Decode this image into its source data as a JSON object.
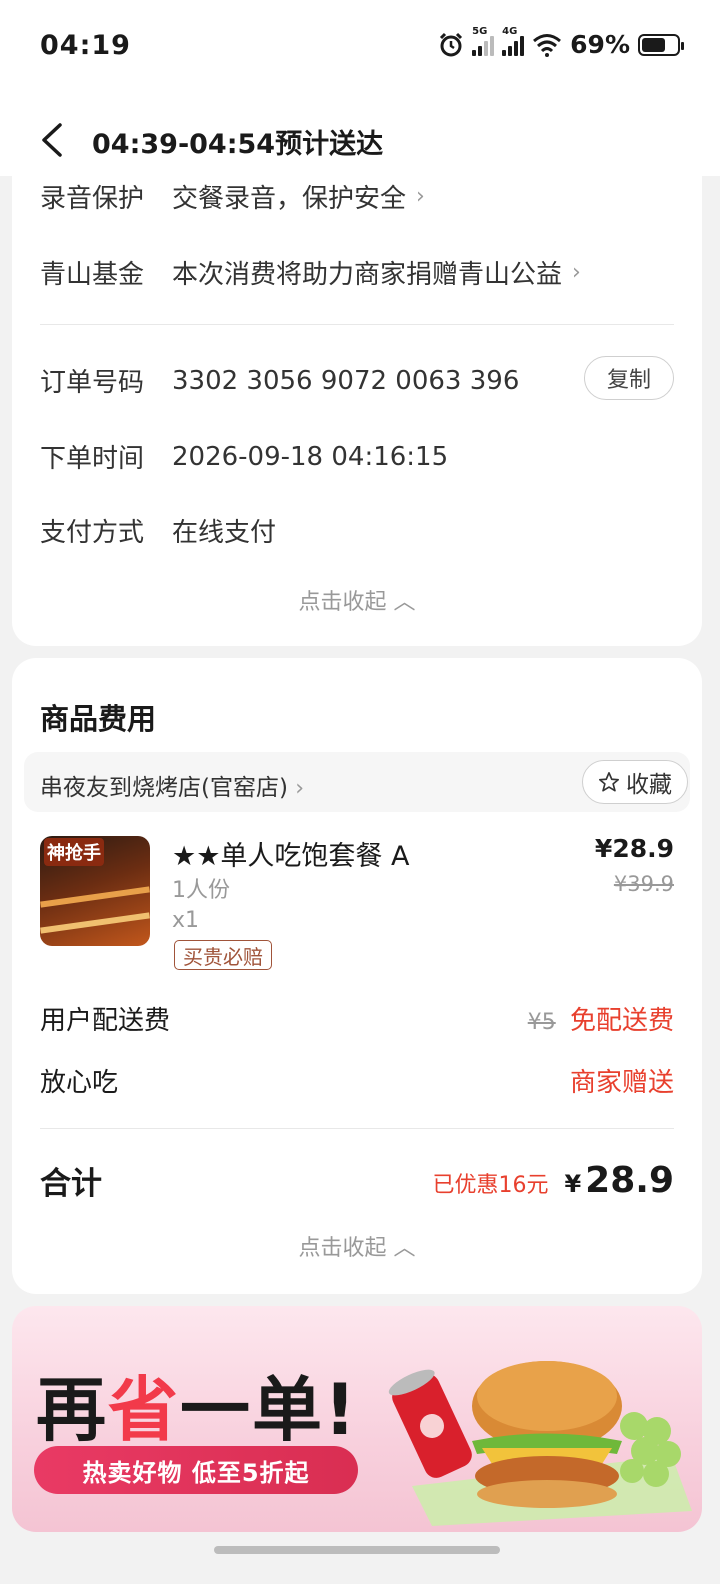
{
  "status_bar": {
    "time": "04:19",
    "signal_a_label": "5G",
    "signal_b_label": "4G",
    "battery_percent": "69%",
    "icons": [
      "alarm-icon",
      "signal-5g-icon",
      "signal-4g-icon",
      "wifi-icon",
      "battery-icon"
    ]
  },
  "nav": {
    "title": "04:39-04:54预计送达",
    "back_icon": "back-chevron-icon"
  },
  "order_info": {
    "rows": [
      {
        "key": "录音保护",
        "value": "交餐录音，保护安全"
      },
      {
        "key": "青山基金",
        "value": "本次消费将助力商家捐赠青山公益"
      },
      {
        "key": "订单号码",
        "value": "3302 3056 9072 0063 396"
      },
      {
        "key": "下单时间",
        "value": "2026-09-18 04:16:15"
      },
      {
        "key": "支付方式",
        "value": "在线支付"
      }
    ],
    "copy_label": "复制",
    "collapse_label": "点击收起"
  },
  "goods": {
    "section_title": "商品费用",
    "shop_name": "串夜友到烧烤店(官窑店)",
    "fav_label": "收藏",
    "item": {
      "thumb_tag": "神抢手",
      "name": "★★单人吃饱套餐 A",
      "spec": "1人份",
      "qty": "x1",
      "badge": "买贵必赔",
      "price": "¥28.9",
      "price_old": "¥39.9"
    },
    "fees": [
      {
        "label": "用户配送费",
        "original": "¥5",
        "value": "免配送费"
      },
      {
        "label": "放心吃",
        "value": "商家赠送"
      }
    ],
    "total": {
      "label": "合计",
      "saved": "已优惠16元",
      "currency": "¥",
      "amount": "28.9"
    },
    "collapse_label": "点击收起"
  },
  "banner": {
    "headline_a": "再",
    "headline_b": "省",
    "headline_c": "一单!",
    "pill": "热卖好物 低至5折起"
  },
  "colors": {
    "accent_red": "#e8402e",
    "banner_pink": "#f8d0dd",
    "pill_red": "#e93a64"
  }
}
